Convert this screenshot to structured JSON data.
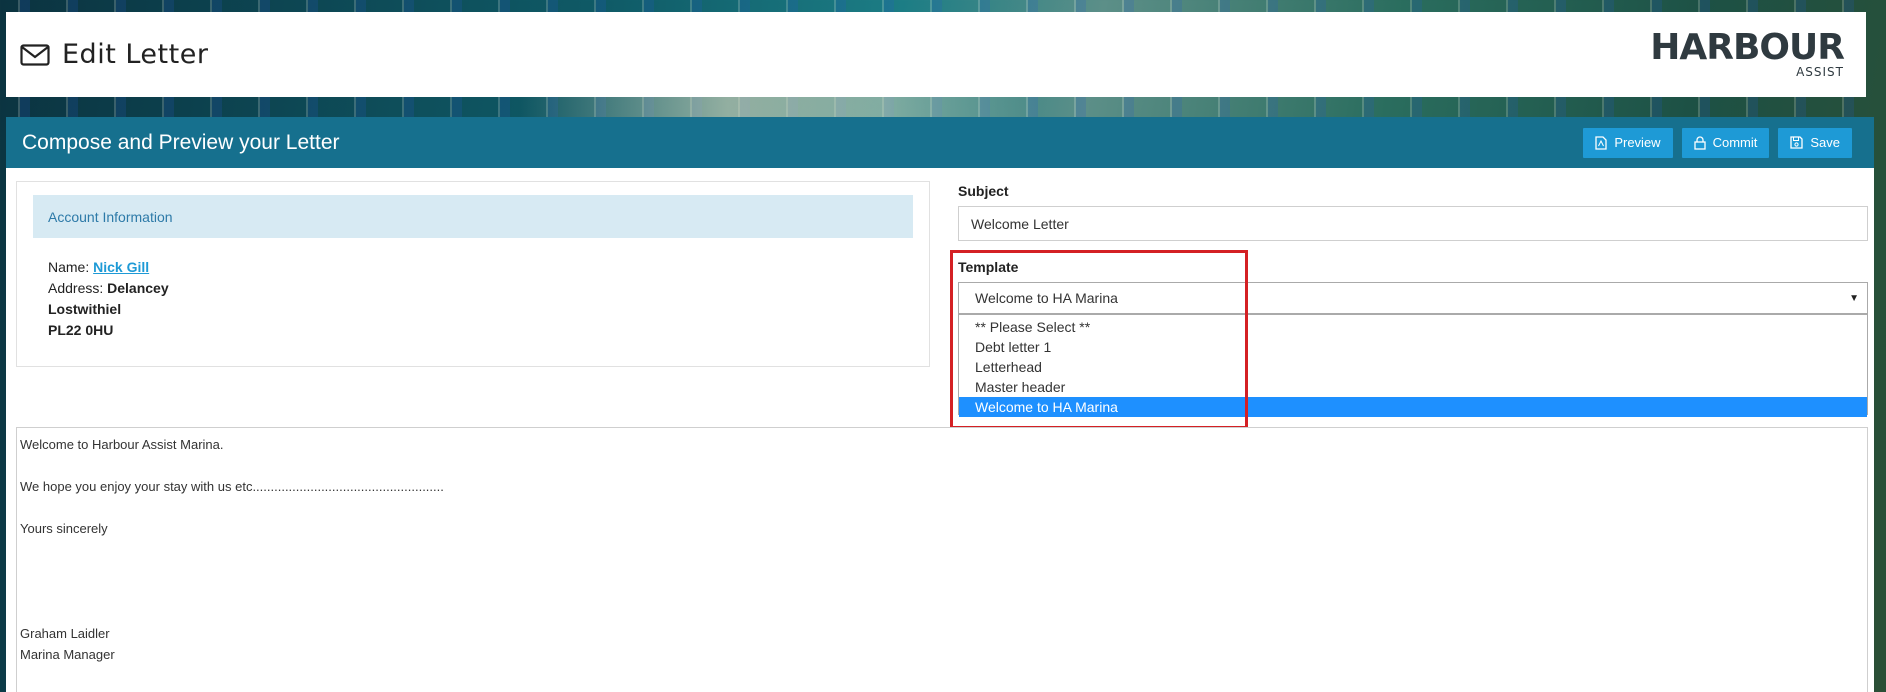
{
  "header": {
    "title": "Edit Letter",
    "logo_main": "HARBOUR",
    "logo_sub": "ASSIST"
  },
  "panel": {
    "title": "Compose and Preview your Letter",
    "buttons": {
      "preview": "Preview",
      "commit": "Commit",
      "save": "Save"
    }
  },
  "account": {
    "heading": "Account Information",
    "name_label": "Name: ",
    "name_value": "Nick Gill",
    "address_label": "Address: ",
    "address_lines": [
      "Delancey",
      "Lostwithiel",
      "PL22 0HU"
    ]
  },
  "form": {
    "subject_label": "Subject",
    "subject_value": "Welcome Letter",
    "template_label": "Template",
    "template_value": "Welcome to HA Marina",
    "template_options": [
      "** Please Select **",
      "Debt letter 1",
      "Letterhead",
      "Master header",
      "Welcome to HA Marina"
    ],
    "selected_index": 4
  },
  "letter": {
    "lines": [
      "Welcome to Harbour Assist Marina.",
      "We hope you enjoy your stay with us etc.....................................................",
      "Yours sincerely",
      "Graham Laidler",
      "Marina Manager"
    ]
  },
  "colors": {
    "accent": "#16708e",
    "button": "#1e9ad6",
    "selected_option": "#1e90ff",
    "highlight_box": "#d42024"
  }
}
